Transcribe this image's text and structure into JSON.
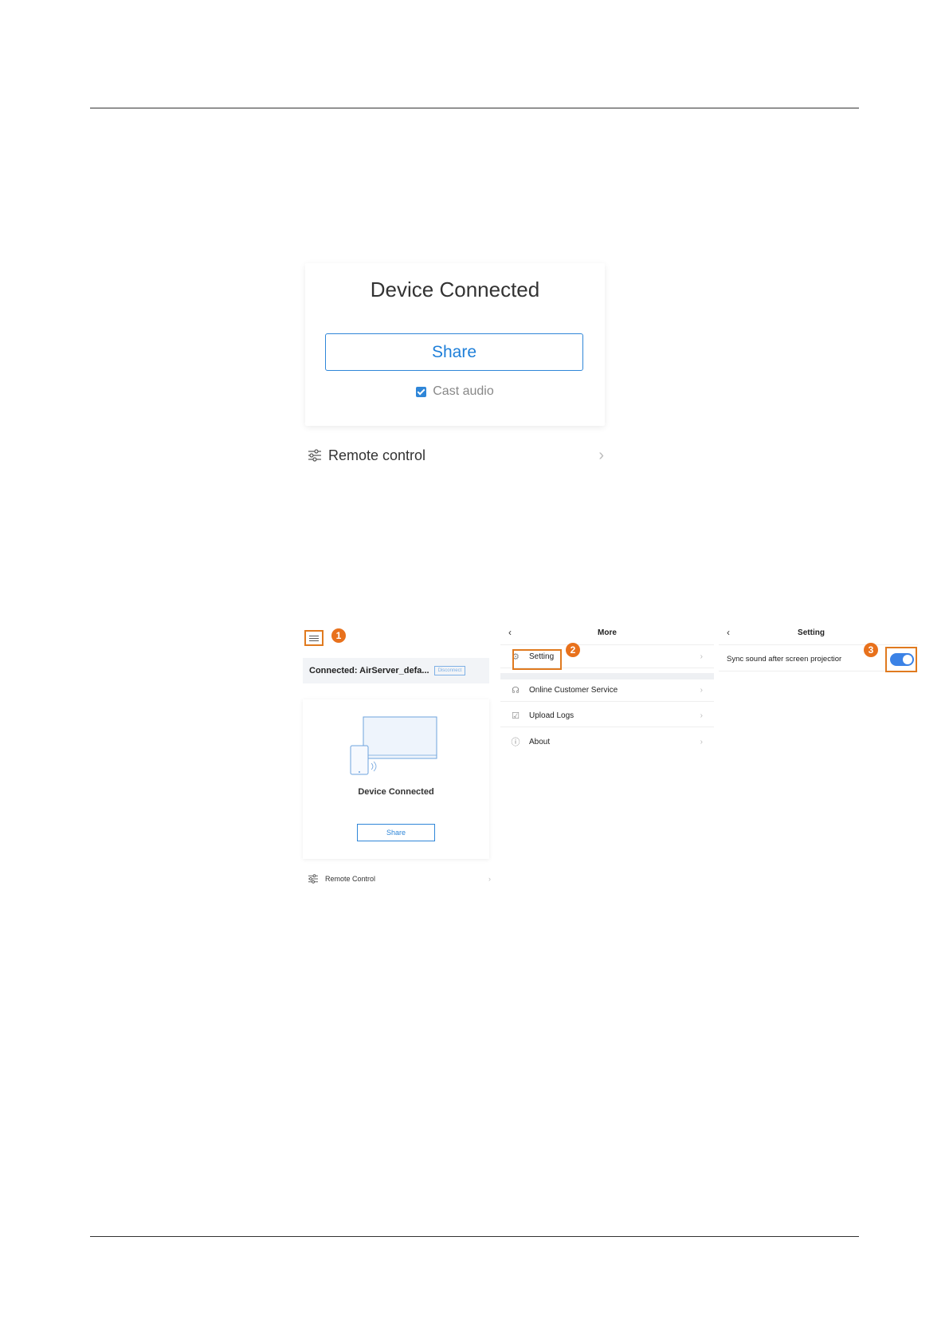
{
  "big": {
    "title": "Device Connected",
    "share_label": "Share",
    "cast_audio_label": "Cast audio",
    "cast_audio_checked": true,
    "remote_label": "Remote control"
  },
  "panel1": {
    "badge": "1",
    "connected_text": "Connected: AirServer_defa...",
    "disconnect_label": "Disconnect",
    "device_connected": "Device Connected",
    "share_label": "Share",
    "remote_label": "Remote Control"
  },
  "panel2": {
    "title": "More",
    "badge": "2",
    "items": [
      {
        "label": "Setting",
        "icon": "gear-icon"
      },
      {
        "label": "Online Customer Service",
        "icon": "headset-icon"
      },
      {
        "label": "Upload Logs",
        "icon": "upload-log-icon"
      },
      {
        "label": "About",
        "icon": "info-icon"
      }
    ]
  },
  "panel3": {
    "title": "Setting",
    "badge": "3",
    "sync_label": "Sync sound after screen projectior",
    "sync_on": true
  },
  "colors": {
    "accent": "#2f86d8",
    "highlight": "#e07a1f",
    "badge": "#e8711c"
  }
}
